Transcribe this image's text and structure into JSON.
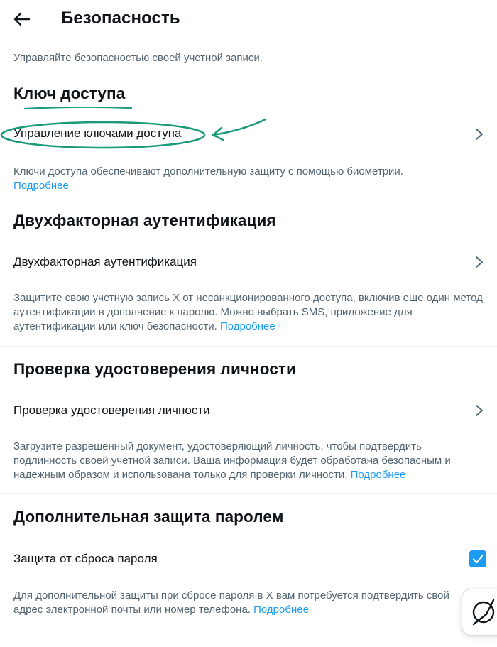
{
  "header": {
    "title": "Безопасность",
    "subtitle": "Управляйте безопасностью своей учетной записи."
  },
  "sections": [
    {
      "title": "Ключ доступа",
      "row_label": "Управление ключами доступа",
      "desc_text": "Ключи доступа обеспечивают дополнительную защиту с помощью биометрии.",
      "link": "Подробнее"
    },
    {
      "title": "Двухфакторная аутентификация",
      "row_label": "Двухфакторная аутентификация",
      "desc_text": "Защитите свою учетную запись X от несанкционированного доступа, включив еще один метод аутентификации в дополнение к паролю. Можно выбрать SMS, приложение для аутентификации или ключ безопасности.",
      "link": "Подробнее"
    },
    {
      "title": "Проверка удостоверения личности",
      "row_label": "Проверка удостоверения личности",
      "desc_text": "Загрузите разрешенный документ, удостоверяющий личность, чтобы подтвердить подлинность своей учетной записи. Ваша информация будет обработана безопасным и надежным образом и использована только для проверки личности.",
      "link": "Подробнее"
    },
    {
      "title": "Дополнительная защита паролем",
      "row_label": "Защита от сброса пароля",
      "checked": true,
      "desc_text": "Для дополнительной защиты при сбросе пароля в X вам потребуется подтвердить свой адрес электронной почты или номер телефона.",
      "link": "Подробнее"
    }
  ],
  "colors": {
    "accent": "#1d9bf0",
    "annotation": "#1a9a7b",
    "text": "#0f1419",
    "secondary": "#536471"
  },
  "icons": {
    "back": "arrow-left-icon",
    "chevron": "chevron-right-icon",
    "check": "checkmark-icon",
    "fab": "compass-icon"
  }
}
